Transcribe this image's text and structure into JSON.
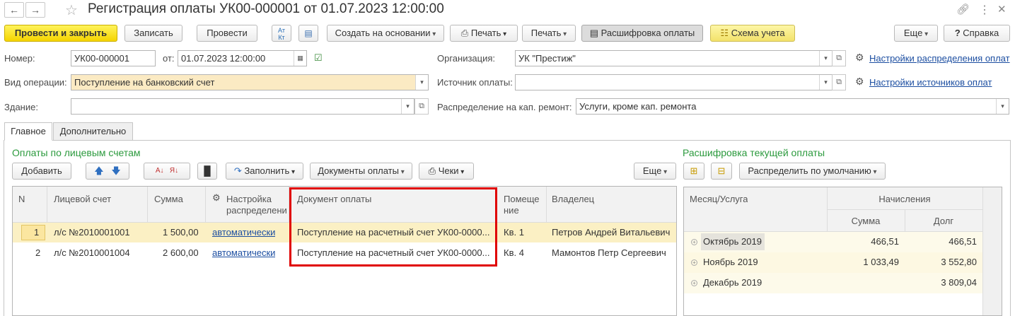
{
  "window": {
    "title": "Регистрация оплаты УК00-000001 от 01.07.2023 12:00:00",
    "icons": [
      "back-arrow-icon",
      "forward-arrow-icon",
      "star-icon",
      "link-icon",
      "more-icon",
      "close-icon"
    ]
  },
  "toolbar": {
    "post_close": "Провести и закрыть",
    "save": "Записать",
    "post": "Провести",
    "dt_kt": "Дт Кт",
    "create_based": "Создать на основании",
    "print1": "Печать",
    "print2": "Печать",
    "breakdown": "Расшифровка оплаты",
    "scheme": "Схема учета",
    "more": "Еще",
    "help": "Справка"
  },
  "form": {
    "number_label": "Номер:",
    "number_value": "УК00-000001",
    "date_label": "от:",
    "date_value": "01.07.2023 12:00:00",
    "operation_label": "Вид операции:",
    "operation_value": "Поступление на банковский счет",
    "building_label": "Здание:",
    "building_value": "",
    "org_label": "Организация:",
    "org_value": "УК \"Престиж\"",
    "source_label": "Источник оплаты:",
    "source_value": "",
    "distribution_label": "Распределение на кап. ремонт:",
    "distribution_value": "Услуги, кроме кап. ремонта",
    "link_distribution": "Настройки распределения оплат",
    "link_sources": "Настройки источников оплат"
  },
  "tabs": [
    "Главное",
    "Дополнительно"
  ],
  "left": {
    "title": "Оплаты по лицевым счетам",
    "add": "Добавить",
    "fill": "Заполнить",
    "documents": "Документы оплаты",
    "checks": "Чеки",
    "more": "Еще",
    "columns": [
      "N",
      "Лицевой счет",
      "Сумма",
      "Настройка распределени",
      "Документ оплаты",
      "Помеще ние",
      "Владелец"
    ],
    "rows": [
      {
        "n": "1",
        "account": "л/с №2010001001",
        "sum": "1 500,00",
        "setting": "автоматически",
        "doc": "Поступление на расчетный счет УК00-0000...",
        "room": "Кв. 1",
        "owner": "Петров Андрей Витальевич"
      },
      {
        "n": "2",
        "account": "л/с №2010001004",
        "sum": "2 600,00",
        "setting": "автоматически",
        "doc": "Поступление на расчетный счет УК00-0000...",
        "room": "Кв. 4",
        "owner": "Мамонтов Петр Сергеевич"
      }
    ]
  },
  "right": {
    "title": "Расшифровка текущей оплаты",
    "distribute": "Распределить по умолчанию",
    "col_month": "Месяц/Услуга",
    "col_charges": "Начисления",
    "col_sum": "Сумма",
    "col_debt": "Долг",
    "rows": [
      {
        "month": "Октябрь 2019",
        "sum": "466,51",
        "debt": "466,51"
      },
      {
        "month": "Ноябрь 2019",
        "sum": "1 033,49",
        "debt": "3 552,80"
      },
      {
        "month": "Декабрь 2019",
        "sum": "",
        "debt": "3 809,04"
      }
    ]
  },
  "colors": {
    "accent_green": "#2b9a3d",
    "primary_yellow": "#f5d400",
    "highlight_red": "#e00000",
    "link_blue": "#1c4ea1"
  }
}
